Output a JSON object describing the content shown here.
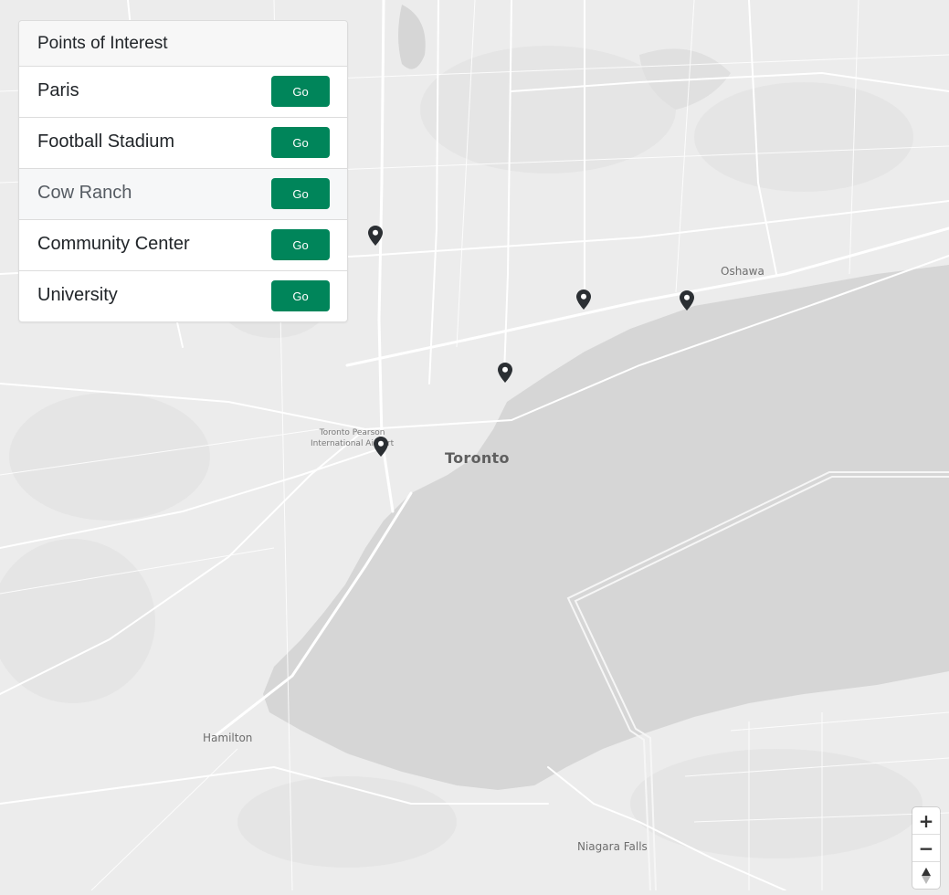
{
  "panel": {
    "title": "Points of Interest",
    "items": [
      {
        "label": "Paris",
        "button": "Go",
        "active": false
      },
      {
        "label": "Football Stadium",
        "button": "Go",
        "active": false
      },
      {
        "label": "Cow Ranch",
        "button": "Go",
        "active": true
      },
      {
        "label": "Community Center",
        "button": "Go",
        "active": false
      },
      {
        "label": "University",
        "button": "Go",
        "active": false
      }
    ]
  },
  "map": {
    "places": {
      "oshawa": "Oshawa",
      "toronto": "Toronto",
      "airport_line1": "Toronto Pearson",
      "airport_line2": "International Airport",
      "hamilton": "Hamilton",
      "niagara": "Niagara Falls"
    },
    "markers": [
      "marker-1",
      "marker-2",
      "marker-3",
      "marker-4",
      "marker-5"
    ],
    "colors": {
      "land": "#ececec",
      "water": "#d6d6d6",
      "road": "#ffffff",
      "marker": "#2b2f33"
    }
  },
  "controls": {
    "zoom_in": "+",
    "zoom_out": "−"
  },
  "colors": {
    "button": "#00855a"
  }
}
